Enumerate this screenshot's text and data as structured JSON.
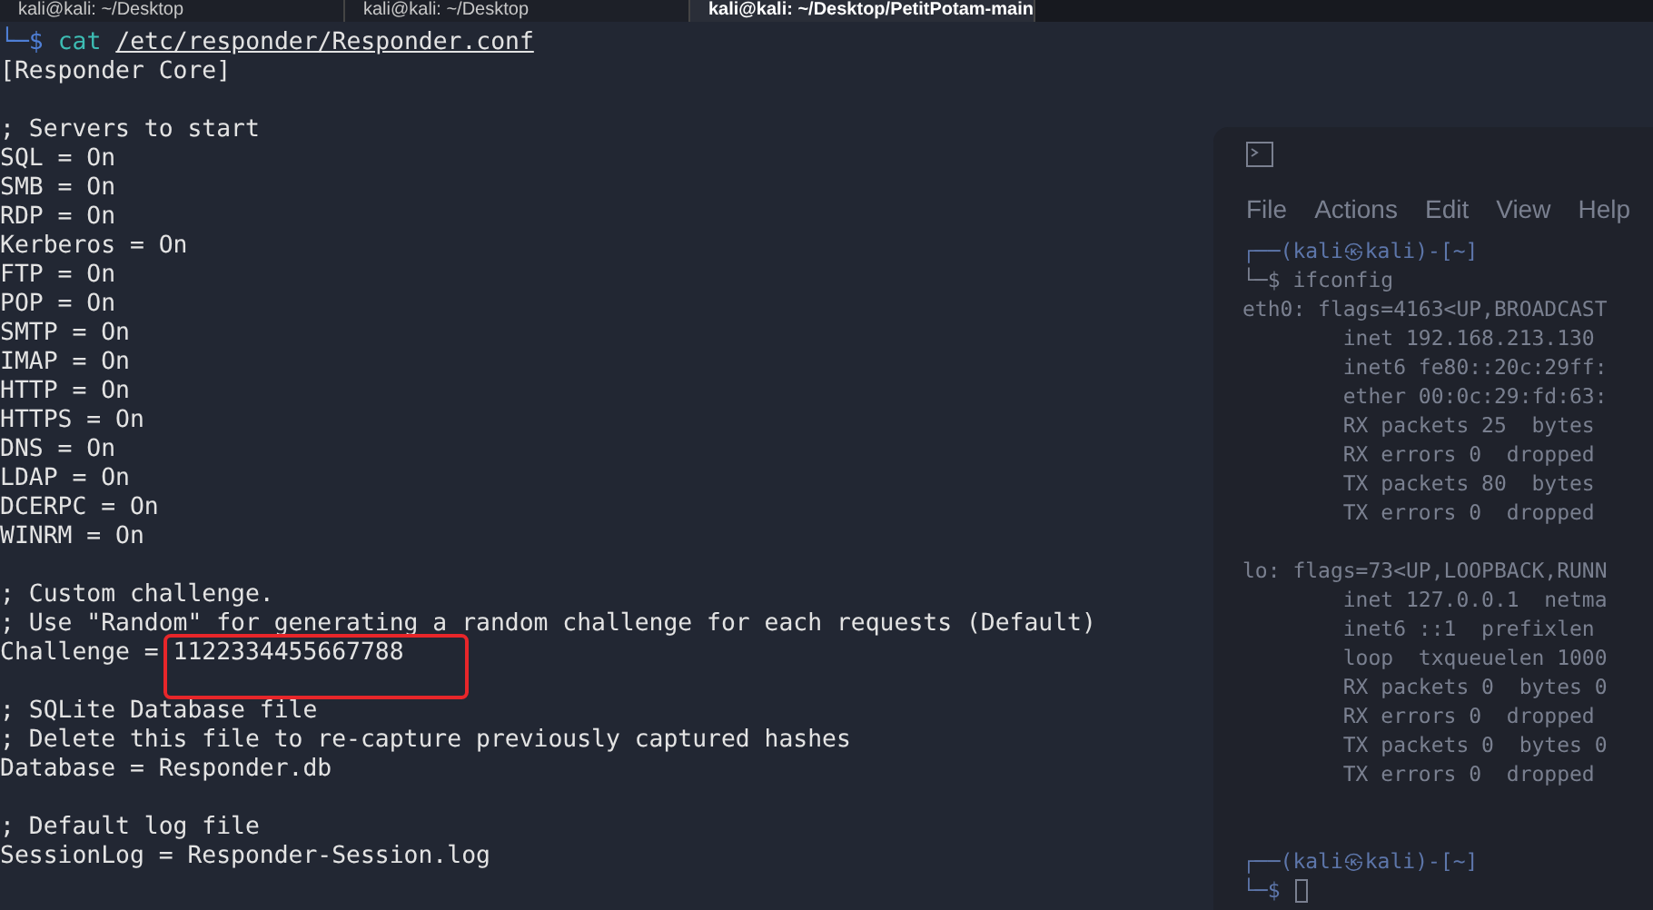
{
  "tabs": [
    {
      "label": "kali@kali: ~/Desktop",
      "selected": false
    },
    {
      "label": "kali@kali: ~/Desktop",
      "selected": false
    },
    {
      "label": "kali@kali: ~/Desktop/PetitPotam-main",
      "selected": true
    }
  ],
  "command": {
    "prompt": "└─$",
    "program": "cat",
    "path": "/etc/responder/Responder.conf"
  },
  "lines": [
    {
      "kind": "text",
      "text": "[Responder Core]"
    },
    {
      "kind": "blank"
    },
    {
      "kind": "text",
      "text": "; Servers to start"
    },
    {
      "kind": "text",
      "text": "SQL = On"
    },
    {
      "kind": "text",
      "text": "SMB = On"
    },
    {
      "kind": "text",
      "text": "RDP = On"
    },
    {
      "kind": "text",
      "text": "Kerberos = On"
    },
    {
      "kind": "text",
      "text": "FTP = On"
    },
    {
      "kind": "text",
      "text": "POP = On"
    },
    {
      "kind": "text",
      "text": "SMTP = On"
    },
    {
      "kind": "text",
      "text": "IMAP = On"
    },
    {
      "kind": "text",
      "text": "HTTP = On"
    },
    {
      "kind": "text",
      "text": "HTTPS = On"
    },
    {
      "kind": "text",
      "text": "DNS = On"
    },
    {
      "kind": "text",
      "text": "LDAP = On"
    },
    {
      "kind": "text",
      "text": "DCERPC = On"
    },
    {
      "kind": "text",
      "text": "WINRM = On"
    },
    {
      "kind": "blank"
    },
    {
      "kind": "text",
      "text": "; Custom challenge."
    },
    {
      "kind": "text",
      "text": "; Use \"Random\" for generating a random challenge for each requests (Default)"
    },
    {
      "kind": "text",
      "text": "Challenge = 1122334455667788"
    },
    {
      "kind": "blank"
    },
    {
      "kind": "text",
      "text": "; SQLite Database file"
    },
    {
      "kind": "text",
      "text": "; Delete this file to re-capture previously captured hashes"
    },
    {
      "kind": "text",
      "text": "Database = Responder.db"
    },
    {
      "kind": "blank"
    },
    {
      "kind": "text",
      "text": "; Default log file"
    },
    {
      "kind": "text",
      "text": "SessionLog = Responder-Session.log"
    }
  ],
  "background_terminal": {
    "menu": [
      "File",
      "Actions",
      "Edit",
      "View",
      "Help"
    ],
    "lines": [
      {
        "kind": "prompt",
        "text": "┌──(kali㉿kali)-[~]"
      },
      {
        "kind": "command",
        "text": "└─$ ifconfig"
      },
      {
        "kind": "output",
        "text": "eth0: flags=4163<UP,BROADCAST"
      },
      {
        "kind": "output",
        "text": "        inet 192.168.213.130"
      },
      {
        "kind": "output",
        "text": "        inet6 fe80::20c:29ff:"
      },
      {
        "kind": "output",
        "text": "        ether 00:0c:29:fd:63:"
      },
      {
        "kind": "output",
        "text": "        RX packets 25  bytes"
      },
      {
        "kind": "output",
        "text": "        RX errors 0  dropped"
      },
      {
        "kind": "output",
        "text": "        TX packets 80  bytes"
      },
      {
        "kind": "output",
        "text": "        TX errors 0  dropped"
      },
      {
        "kind": "blank"
      },
      {
        "kind": "output",
        "text": "lo: flags=73<UP,LOOPBACK,RUNN"
      },
      {
        "kind": "output",
        "text": "        inet 127.0.0.1  netma"
      },
      {
        "kind": "output",
        "text": "        inet6 ::1  prefixlen"
      },
      {
        "kind": "output",
        "text": "        loop  txqueuelen 1000"
      },
      {
        "kind": "output",
        "text": "        RX packets 0  bytes 0"
      },
      {
        "kind": "output",
        "text": "        RX errors 0  dropped"
      },
      {
        "kind": "output",
        "text": "        TX packets 0  bytes 0"
      },
      {
        "kind": "output",
        "text": "        TX errors 0  dropped"
      },
      {
        "kind": "blank"
      },
      {
        "kind": "blank"
      },
      {
        "kind": "prompt",
        "text": "┌──(kali㉿kali)-[~]"
      },
      {
        "kind": "cursor",
        "text": "└─$"
      }
    ]
  }
}
